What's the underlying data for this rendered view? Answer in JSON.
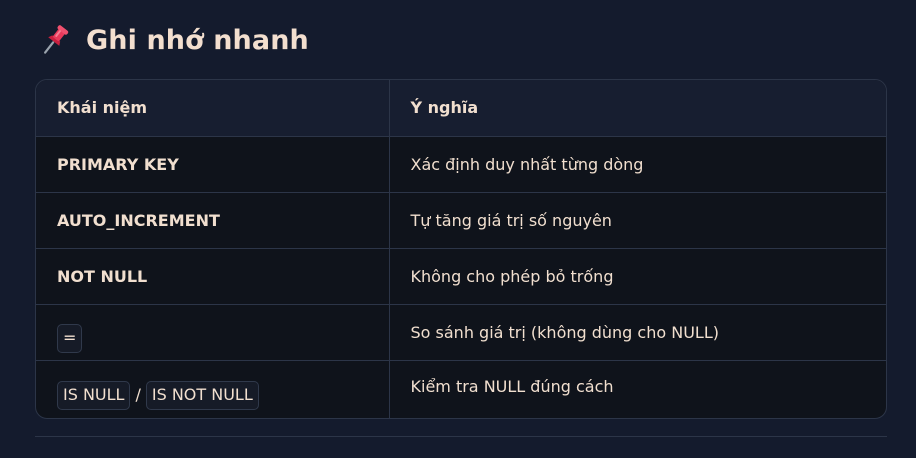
{
  "heading": {
    "icon": "pushpin-icon",
    "title": "Ghi nhớ nhanh"
  },
  "table": {
    "headers": [
      "Khái niệm",
      "Ý nghĩa"
    ],
    "rows": [
      {
        "concept": "PRIMARY KEY",
        "meaning": "Xác định duy nhất từng dòng"
      },
      {
        "concept": "AUTO_INCREMENT",
        "meaning": "Tự tăng giá trị số nguyên"
      },
      {
        "concept": "NOT NULL",
        "meaning": "Không cho phép bỏ trống"
      },
      {
        "concept": "=",
        "meaning": "So sánh giá trị (không dùng cho NULL)"
      },
      {
        "concept_a": "IS NULL",
        "separator": "/",
        "concept_b": "IS NOT NULL",
        "meaning": "Kiểm tra NULL đúng cách"
      }
    ]
  },
  "colors": {
    "background": "#141b2d",
    "table_body": "#0f131b",
    "header_row": "#171e30",
    "text": "#f1dfcf",
    "border": "#2c3548",
    "pin": "#e8395a"
  }
}
